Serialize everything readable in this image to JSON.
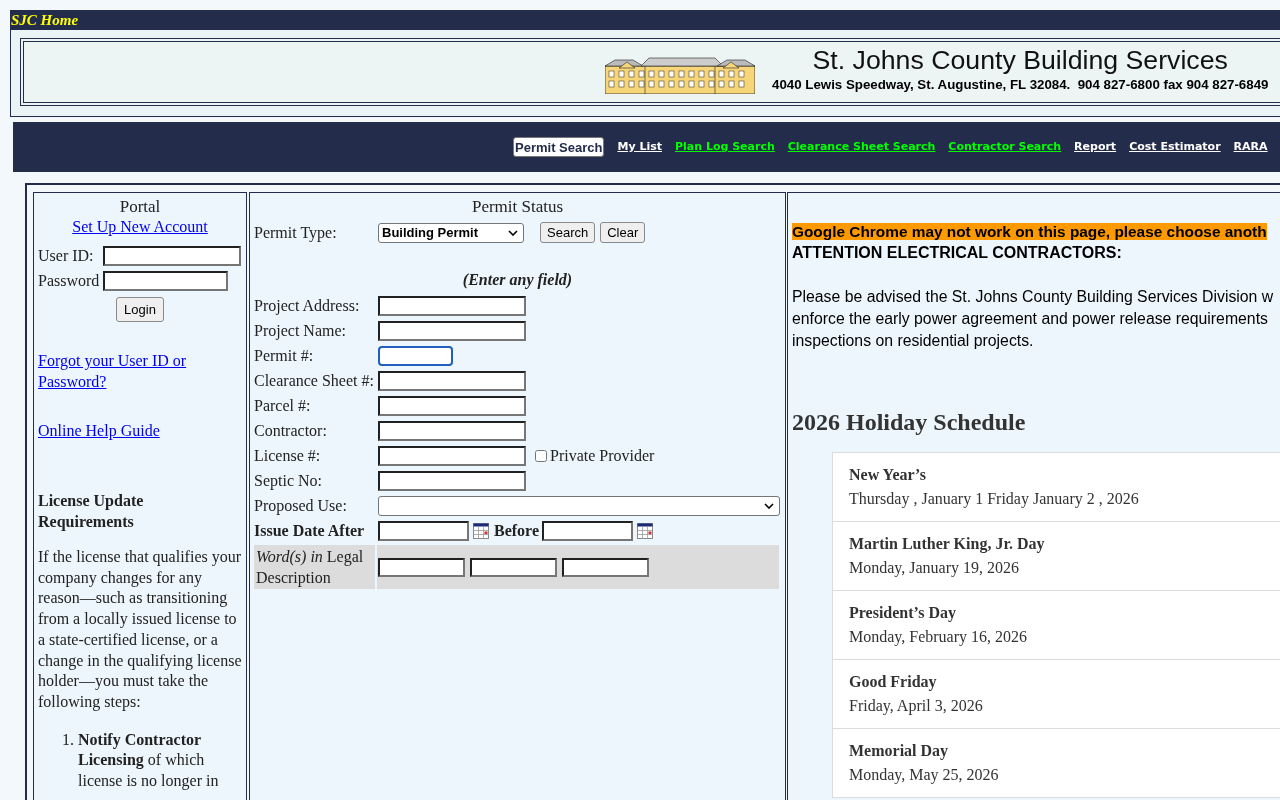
{
  "header": {
    "home_link": "SJC Home",
    "title": "St. Johns County Building Services",
    "address": "4040 Lewis Speedway, St. Augustine, FL 32084.  904 827-6800 fax 904 827-6849"
  },
  "nav": [
    {
      "label": "Permit Search",
      "selected": true,
      "color": "#ffffff"
    },
    {
      "label": "My List",
      "selected": false,
      "color": "#ffffff"
    },
    {
      "label": "Plan Log Search",
      "selected": false,
      "color": "#00ff00"
    },
    {
      "label": "Clearance Sheet Search",
      "selected": false,
      "color": "#00ff00"
    },
    {
      "label": "Contractor Search",
      "selected": false,
      "color": "#00ff00"
    },
    {
      "label": "Report",
      "selected": false,
      "color": "#ffffff"
    },
    {
      "label": "Cost Estimator",
      "selected": false,
      "color": "#ffffff"
    },
    {
      "label": "RARA",
      "selected": false,
      "color": "#ffffff"
    }
  ],
  "portal": {
    "title": "Portal",
    "signup_link": "Set Up New Account",
    "user_id_label": "User ID:",
    "password_label": "Password",
    "login_button": "Login",
    "forgot_link": "Forgot your User ID or Password?",
    "help_link": "Online Help Guide",
    "license_heading": "License Update Requirements",
    "license_text": "If the license that qualifies your company changes for any reason—such as transitioning from a locally issued license to a state-certified license, or a change in the qualifying license holder—you must take the following steps:",
    "steps": [
      {
        "number": "1.",
        "text": "**Notify Contractor Licensing** of which license is no longer in"
      }
    ]
  },
  "permit_status": {
    "title": "Permit Status",
    "permit_type_label": "Permit Type:",
    "permit_type_value": "Building Permit",
    "search_button": "Search",
    "clear_button": "Clear",
    "hint": "(Enter any field)",
    "fields": [
      {
        "label": "Project Address:",
        "kind": "text",
        "focused": false
      },
      {
        "label": "Project Name:",
        "kind": "text",
        "focused": false
      },
      {
        "label": "Permit #:",
        "kind": "short",
        "focused": true
      },
      {
        "label": "Clearance Sheet #:",
        "kind": "text",
        "focused": false
      },
      {
        "label": "Parcel #:",
        "kind": "text",
        "focused": false
      },
      {
        "label": "Contractor:",
        "kind": "text",
        "focused": false
      },
      {
        "label": "License #:",
        "kind": "text",
        "focused": false,
        "option": {
          "label": "Private Provider",
          "checked": false
        }
      },
      {
        "label": "Septic No:",
        "kind": "text",
        "focused": false
      },
      {
        "label": "Proposed Use:",
        "kind": "select",
        "focused": false
      }
    ],
    "date_row": {
      "after_label": "Issue Date After",
      "before_label": "Before"
    },
    "legal": {
      "label": "*Word(s) in* Legal Description",
      "fields": [
        {
          "focused": false
        },
        {
          "focused": false
        },
        {
          "focused": false
        }
      ]
    }
  },
  "notices": {
    "browser_warning": "Google Chrome may not work on this page, please choose anoth",
    "heading": "ATTENTION ELECTRICAL CONTRACTORS:",
    "lines": [
      "Please be advised the St. Johns County Building Services Division w",
      "enforce the early power agreement and power release requirements",
      "inspections on residential projects."
    ],
    "holiday_title": "2026 Holiday Schedule",
    "holidays": [
      {
        "name": "New Year’s",
        "date": "Thursday , January 1 Friday January 2 , 2026"
      },
      {
        "name": "Martin Luther King, Jr. Day",
        "date": "Monday, January 19, 2026"
      },
      {
        "name": "President’s Day",
        "date": "Monday, February 16, 2026"
      },
      {
        "name": "Good Friday",
        "date": "Friday, April 3, 2026"
      },
      {
        "name": "Memorial Day",
        "date": "Monday, May 25, 2026"
      }
    ]
  }
}
